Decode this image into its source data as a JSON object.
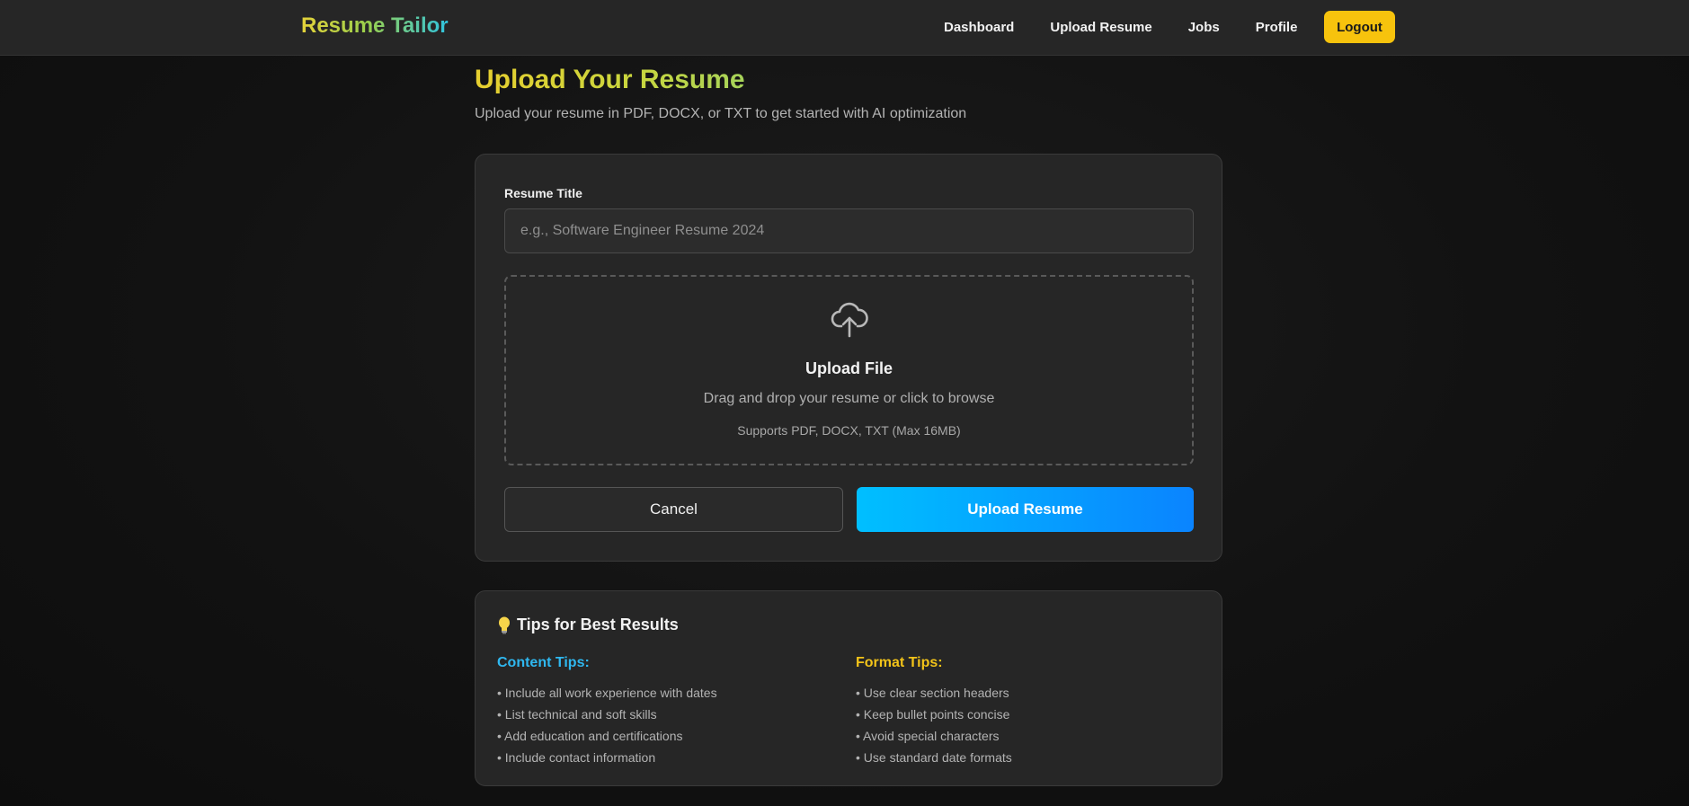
{
  "nav": {
    "brand": "Resume Tailor",
    "links": [
      "Dashboard",
      "Upload Resume",
      "Jobs",
      "Profile"
    ],
    "logout": "Logout"
  },
  "page": {
    "title": "Upload Your Resume",
    "subtitle": "Upload your resume in PDF, DOCX, or TXT to get started with AI optimization"
  },
  "form": {
    "title_label": "Resume Title",
    "title_value": "",
    "title_placeholder": "e.g., Software Engineer Resume 2024",
    "dropzone": {
      "icon": "cloud-upload-icon",
      "title": "Upload File",
      "subtitle": "Drag and drop your resume or click to browse",
      "note": "Supports PDF, DOCX, TXT (Max 16MB)"
    },
    "cancel_label": "Cancel",
    "upload_label": "Upload Resume"
  },
  "tips": {
    "icon": "lightbulb-icon",
    "title": "Tips for Best Results",
    "content": {
      "heading": "Content Tips:",
      "items": [
        "• Include all work experience with dates",
        "• List technical and soft skills",
        "• Add education and certifications",
        "• Include contact information"
      ]
    },
    "format": {
      "heading": "Format Tips:",
      "items": [
        "• Use clear section headers",
        "• Keep bullet points concise",
        "• Avoid special characters",
        "• Use standard date formats"
      ]
    }
  },
  "colors": {
    "accent_yellow": "#f7c30d",
    "accent_blue": "#0a84ff",
    "content_tips": "#2fb8f0",
    "format_tips": "#f2c319"
  }
}
